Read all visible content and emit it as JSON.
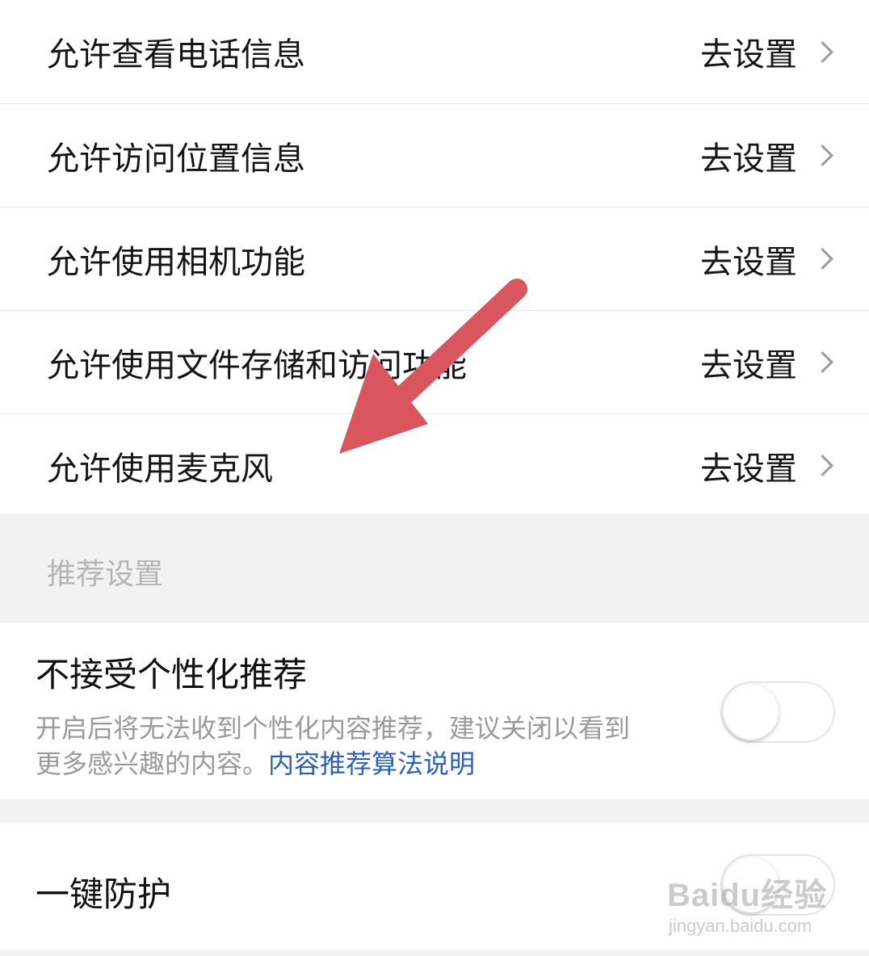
{
  "permissions": [
    {
      "label": "允许查看电话信息",
      "action": "去设置"
    },
    {
      "label": "允许访问位置信息",
      "action": "去设置"
    },
    {
      "label": "允许使用相机功能",
      "action": "去设置"
    },
    {
      "label": "允许使用文件存储和访问功能",
      "action": "去设置"
    },
    {
      "label": "允许使用麦克风",
      "action": "去设置"
    }
  ],
  "recommend_section": {
    "header": "推荐设置"
  },
  "personalized": {
    "title": "不接受个性化推荐",
    "description": "开启后将无法收到个性化内容推荐，建议关闭以看到更多感兴趣的内容。",
    "link": "内容推荐算法说明",
    "enabled": false
  },
  "protection": {
    "title": "一键防护",
    "enabled": false
  },
  "watermark": {
    "logo": "Baidu经验",
    "url": "jingyan.baidu.com"
  },
  "colors": {
    "annotation_arrow": "#d9565f",
    "link": "#2f5fb8"
  }
}
